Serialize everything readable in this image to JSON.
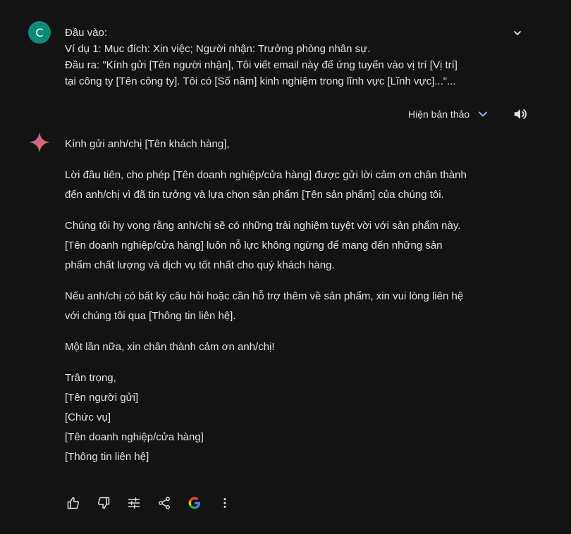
{
  "user": {
    "avatar_letter": "C",
    "prompt_lines": [
      "Đầu vào:",
      "Ví dụ 1: Mục đích: Xin việc; Người nhận: Trưởng phòng nhân sự.",
      "Đầu ra: \"Kính gửi [Tên người nhận], Tôi viết email này để ứng tuyển vào vị trí [Vị trí]",
      "tại công ty [Tên công ty]. Tôi có [Số năm] kinh nghiệm trong lĩnh vực [Lĩnh vực]...\"..."
    ]
  },
  "drafts": {
    "label": "Hiện bản thảo"
  },
  "response": {
    "p1": "Kính gửi anh/chị [Tên khách hàng],",
    "p2": [
      "Lời đầu tiên, cho phép [Tên doanh nghiệp/cửa hàng] được gửi lời cảm ơn chân thành",
      "đến anh/chị vì đã tin tưởng và lựa chọn sản phẩm [Tên sản phẩm] của chúng tôi."
    ],
    "p3": [
      "Chúng tôi hy vọng rằng anh/chị sẽ có những trải nghiệm tuyệt vời với sản phẩm này.",
      "[Tên doanh nghiệp/cửa hàng] luôn nỗ lực không ngừng để mang đến những sản",
      "phẩm chất lượng và dịch vụ tốt nhất cho quý khách hàng."
    ],
    "p4": [
      "Nếu anh/chị có bất kỳ câu hỏi hoặc cần hỗ trợ thêm về sản phẩm, xin vui lòng liên hệ",
      "với chúng tôi qua [Thông tin liên hệ]."
    ],
    "p5": "Một lần nữa, xin chân thành cảm ơn anh/chị!",
    "signature": [
      "Trân trọng,",
      "[Tên người gửi]",
      "[Chức vụ]",
      "[Tên doanh nghiệp/cửa hàng]",
      "[Thông tin liên hệ]"
    ]
  },
  "icons": {
    "expand": "chevron-down-icon",
    "drafts": "chevron-down-icon",
    "speaker": "speaker-icon",
    "sparkle": "gemini-sparkle-icon",
    "actions": [
      "thumb-up-icon",
      "thumb-down-icon",
      "tune-icon",
      "share-icon",
      "google-icon",
      "more-vert-icon"
    ]
  },
  "colors": {
    "background": "#131314",
    "text": "#e3e3e3",
    "avatar": "#0f8a7a",
    "accent": "#8ab4f8"
  }
}
